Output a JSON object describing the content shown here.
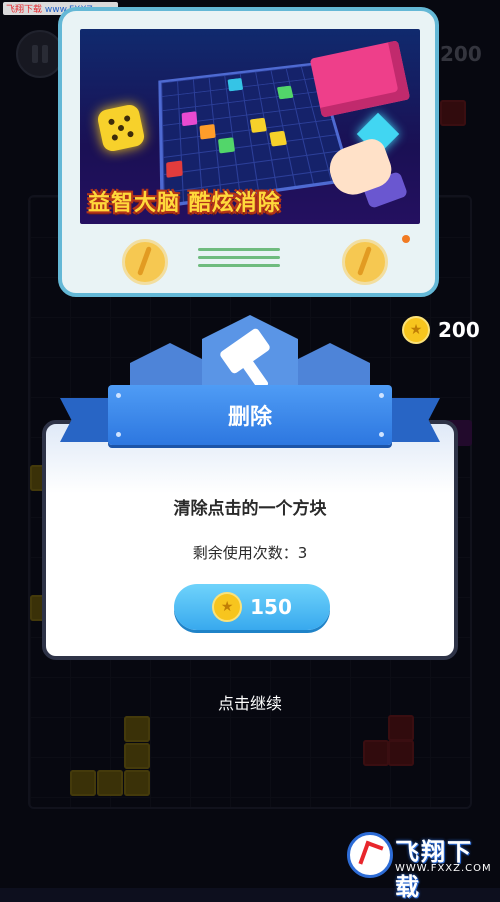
{
  "watermark": {
    "site": "飞翔下载",
    "url": "www.FXXZ.com"
  },
  "top_bar": {
    "score": "200"
  },
  "advertisement": {
    "caption": "益智大脑 酷炫消除"
  },
  "coins": {
    "amount": "200",
    "icon": "star-coin-icon"
  },
  "dialog": {
    "title": "删除",
    "description": "清除点击的一个方块",
    "remaining_label": "剩余使用次数：3",
    "price": "150",
    "price_icon": "star-coin-icon",
    "badge_icon": "hammer-icon"
  },
  "continue_label": "点击继续",
  "brand": {
    "name": "飞翔下载",
    "url": "WWW.FXXZ.COM"
  },
  "colors": {
    "background": "#0d0f1e",
    "ribbon": "#2d77e0",
    "button": "#38a9ee",
    "coin": "#f7c51e",
    "ad_frame": "#64b8d6"
  }
}
